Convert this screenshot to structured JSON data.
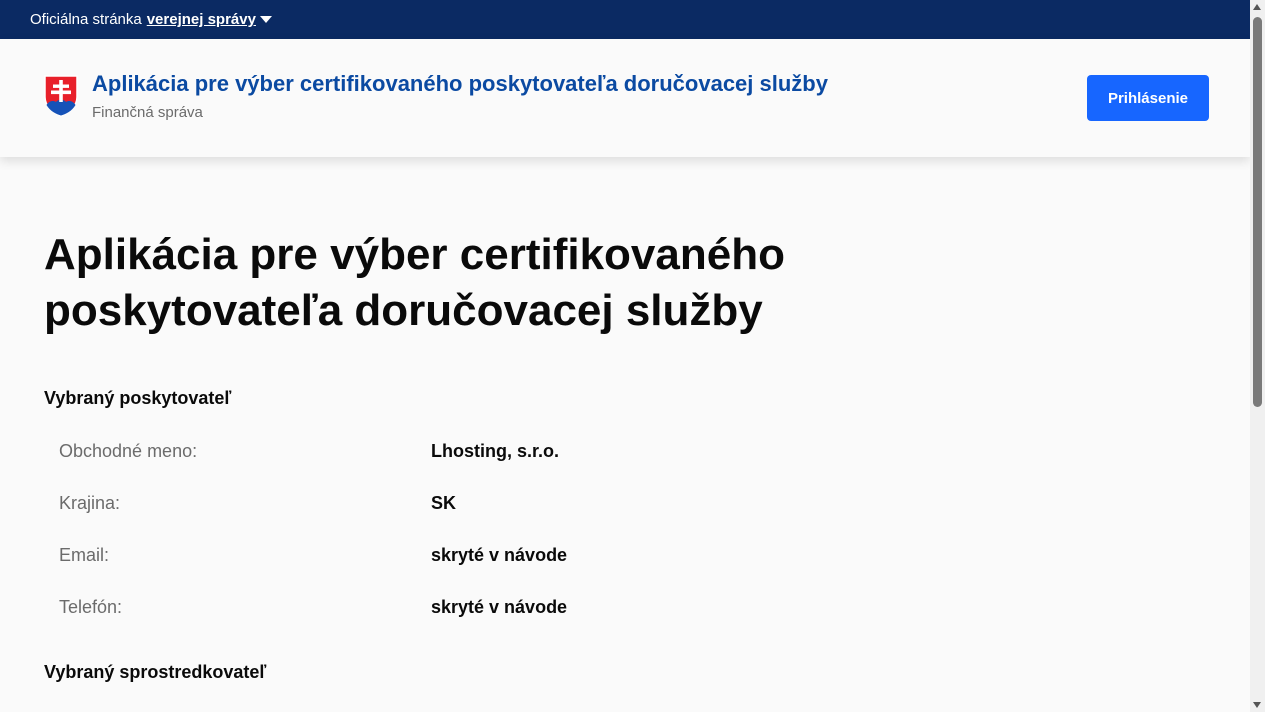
{
  "govbar": {
    "label": "Oficiálna stránka",
    "link": "verejnej správy"
  },
  "header": {
    "app_title": "Aplikácia pre výber certifikovaného poskytovateľa doručovacej služby",
    "org": "Finančná správa",
    "login_label": "Prihlásenie"
  },
  "main": {
    "heading": "Aplikácia pre výber certifikovaného poskytovateľa doručovacej služby",
    "provider_section": "Vybraný poskytovateľ",
    "provider_rows": [
      {
        "label": "Obchodné meno:",
        "value": "Lhosting, s.r.o."
      },
      {
        "label": "Krajina:",
        "value": "SK"
      },
      {
        "label": "Email:",
        "value": "skryté v návode"
      },
      {
        "label": "Telefón:",
        "value": "skryté v návode"
      }
    ],
    "intermediary_section": "Vybraný sprostredkovateľ"
  },
  "colors": {
    "govbar_bg": "#0b2a63",
    "brand_title": "#0b4aa2",
    "primary_button": "#1766ff"
  },
  "icons": {
    "crest": "slovak-coat-of-arms-icon",
    "caret": "caret-down-icon"
  }
}
